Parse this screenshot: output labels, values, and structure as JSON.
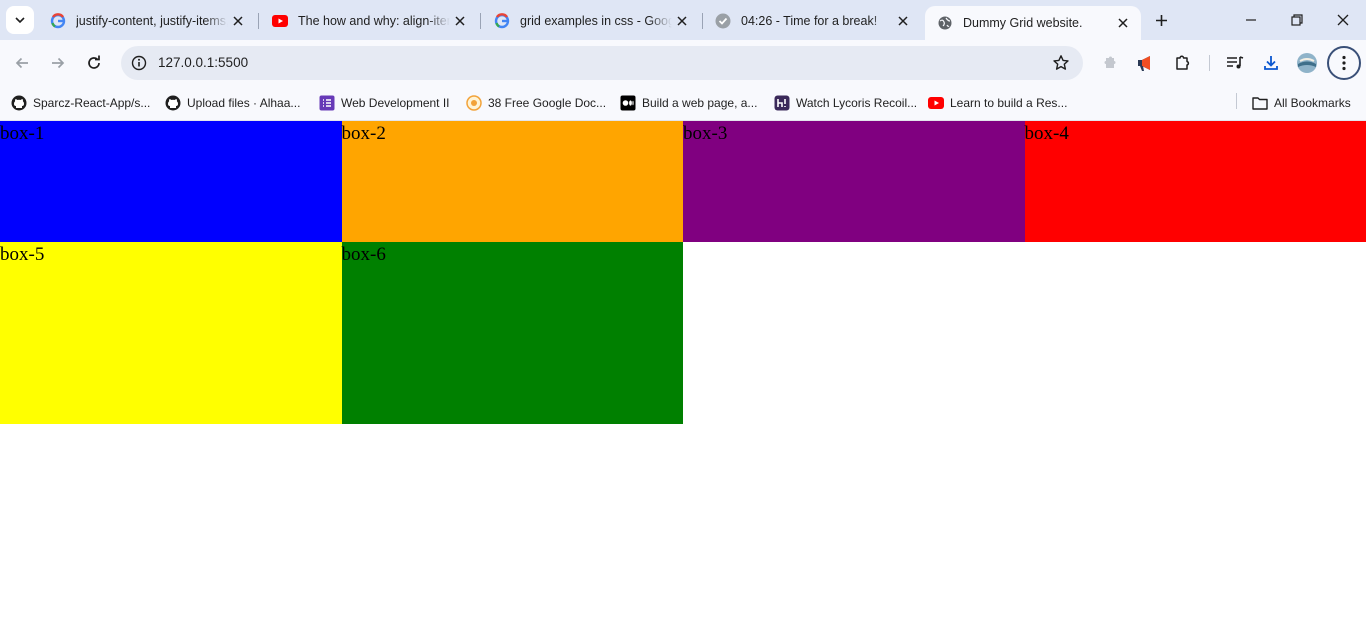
{
  "tabs": [
    {
      "title": "justify-content, justify-items,",
      "favicon": "google-icon"
    },
    {
      "title": "The how and why: align-item",
      "favicon": "youtube-icon"
    },
    {
      "title": "grid examples in css - Googl",
      "favicon": "google-icon"
    },
    {
      "title": "04:26 - Time for a break!",
      "favicon": "check-circle-icon"
    },
    {
      "title": "Dummy Grid website.",
      "favicon": "globe-icon",
      "active": true
    }
  ],
  "address_bar": {
    "url": "127.0.0.1:5500"
  },
  "bookmarks": [
    {
      "label": "Sparcz-React-App/s...",
      "icon": "github-icon"
    },
    {
      "label": "Upload files · Alhaa...",
      "icon": "github-icon"
    },
    {
      "label": "Web Development II",
      "icon": "purple-list-icon"
    },
    {
      "label": "38 Free Google Doc...",
      "icon": "orange-circle-icon"
    },
    {
      "label": "Build a web page, a...",
      "icon": "medium-icon"
    },
    {
      "label": "Watch Lycoris Recoil...",
      "icon": "hianime-icon"
    },
    {
      "label": "Learn to build a Res...",
      "icon": "youtube-icon"
    }
  ],
  "all_bookmarks_label": "All Bookmarks",
  "page": {
    "boxes": [
      {
        "label": "box-1",
        "color": "#0000ff"
      },
      {
        "label": "box-2",
        "color": "#ffa500"
      },
      {
        "label": "box-3",
        "color": "#800080"
      },
      {
        "label": "box-4",
        "color": "#ff0000"
      },
      {
        "label": "box-5",
        "color": "#ffff00"
      },
      {
        "label": "box-6",
        "color": "#008000"
      }
    ]
  }
}
